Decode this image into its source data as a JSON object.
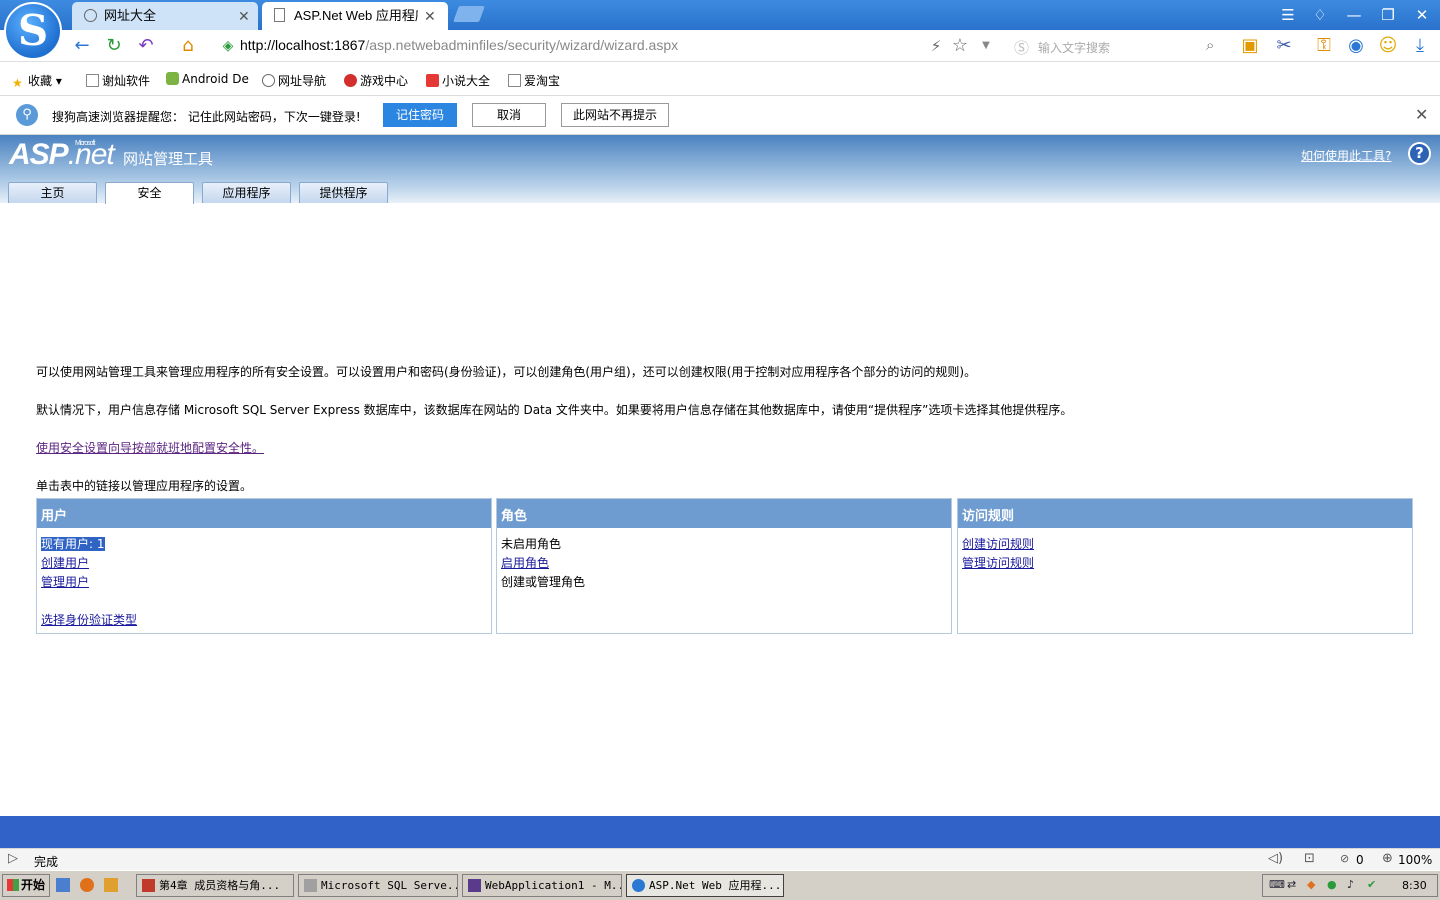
{
  "browser": {
    "tabs": [
      {
        "title": "网址大全",
        "close": "✕"
      },
      {
        "title": "ASP.Net Web 应用程序",
        "close": "✕"
      }
    ],
    "url": {
      "host": "http://localhost:1867",
      "path": "/asp.netwebadminfiles/security/wizard/wizard.aspx"
    },
    "search_placeholder": "输入文字搜索",
    "bookmarks": [
      "收藏",
      "谢灿软件",
      "Android De",
      "网址导航",
      "游戏中心",
      "小说大全",
      "爱淘宝"
    ],
    "notify": {
      "message": "搜狗高速浏览器提醒您： 记住此网站密码，下次一键登录!",
      "remember": "记住密码",
      "cancel": "取消",
      "never": "此网站不再提示"
    }
  },
  "app": {
    "logo": {
      "asp": "ASP",
      "net": ".net",
      "ms": "Microsoft"
    },
    "title": "网站管理工具",
    "howto": "如何使用此工具?",
    "help": "?",
    "tabs": [
      "主页",
      "安全",
      "应用程序",
      "提供程序"
    ],
    "active_tab": "安全"
  },
  "content": {
    "para1": "可以使用网站管理工具来管理应用程序的所有安全设置。可以设置用户和密码(身份验证)，可以创建角色(用户组)，还可以创建权限(用于控制对应用程序各个部分的访问的规则)。",
    "para2": "默认情况下，用户信息存储 Microsoft SQL Server Express 数据库中，该数据库在网站的 Data 文件夹中。如果要将用户信息存储在其他数据库中，请使用“提供程序”选项卡选择其他提供程序。",
    "wizard_link": "使用安全设置向导按部就班地配置安全性。",
    "para3": "单击表中的链接以管理应用程序的设置。",
    "panels": {
      "users": {
        "header": "用户",
        "existing": "现有用户: 1",
        "create": "创建用户",
        "manage": "管理用户",
        "auth_type": "选择身份验证类型"
      },
      "roles": {
        "header": "角色",
        "disabled": "未启用角色",
        "enable": "启用角色",
        "create_manage": "创建或管理角色"
      },
      "access": {
        "header": "访问规则",
        "create": "创建访问规则",
        "manage": "管理访问规则"
      }
    }
  },
  "status": {
    "text": "完成",
    "ad_count": "0",
    "zoom": "100%"
  },
  "taskbar": {
    "start": "开始",
    "tasks": [
      "第4章 成员资格与角...",
      "Microsoft SQL Serve...",
      "WebApplication1 - M...",
      "ASP.Net Web 应用程..."
    ],
    "clock": "8:30"
  },
  "colors": {
    "header_blue": "#4a82c0",
    "panel_header": "#6f9cd0",
    "footer_band": "#3162c8",
    "accent": "#2a86e0"
  }
}
